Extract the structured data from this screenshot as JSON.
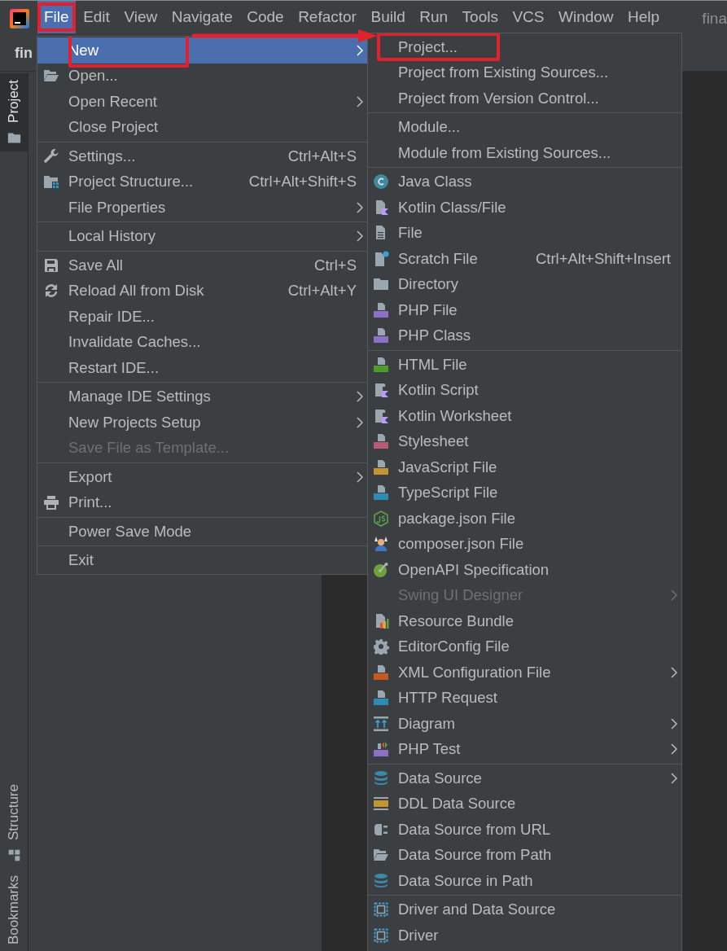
{
  "menu_bar": {
    "items": [
      {
        "label": "File",
        "selected": true,
        "highlighted": true
      },
      {
        "label": "Edit",
        "selected": false,
        "highlighted": false
      },
      {
        "label": "View",
        "selected": false,
        "highlighted": false
      },
      {
        "label": "Navigate",
        "selected": false,
        "highlighted": false
      },
      {
        "label": "Code",
        "selected": false,
        "highlighted": false
      },
      {
        "label": "Refactor",
        "selected": false,
        "highlighted": false
      },
      {
        "label": "Build",
        "selected": false,
        "highlighted": false
      },
      {
        "label": "Run",
        "selected": false,
        "highlighted": false
      },
      {
        "label": "Tools",
        "selected": false,
        "highlighted": false
      },
      {
        "label": "VCS",
        "selected": false,
        "highlighted": false
      },
      {
        "label": "Window",
        "selected": false,
        "highlighted": false
      },
      {
        "label": "Help",
        "selected": false,
        "highlighted": false
      }
    ],
    "title": "fina"
  },
  "navigation_bar": {
    "label": "fin"
  },
  "tool_stripe": [
    {
      "label": "Project",
      "kind": "folder",
      "selected": true
    },
    {
      "label": "Structure",
      "kind": "structure",
      "selected": false
    },
    {
      "label": "Bookmarks",
      "kind": "plain",
      "selected": false
    }
  ],
  "file_menu": {
    "arrow_to_submenu": true,
    "groups": [
      [
        {
          "label": "New",
          "kind": "plain",
          "selected": true,
          "disabled": false,
          "submenu": true,
          "highlighted": true
        },
        {
          "label": "Open...",
          "kind": "folder-open",
          "selected": false,
          "disabled": false,
          "submenu": false,
          "highlighted": false
        },
        {
          "label": "Open Recent",
          "kind": "plain",
          "selected": false,
          "disabled": false,
          "submenu": true,
          "highlighted": false
        },
        {
          "label": "Close Project",
          "kind": "plain",
          "selected": false,
          "disabled": false,
          "submenu": false,
          "highlighted": false
        }
      ],
      [
        {
          "label": "Settings...",
          "kind": "wrench",
          "shortcut": "Ctrl+Alt+S",
          "selected": false,
          "disabled": false,
          "submenu": false,
          "highlighted": false
        },
        {
          "label": "Project Structure...",
          "kind": "project-structure",
          "shortcut": "Ctrl+Alt+Shift+S",
          "selected": false,
          "disabled": false,
          "submenu": false,
          "highlighted": false
        },
        {
          "label": "File Properties",
          "kind": "plain",
          "selected": false,
          "disabled": false,
          "submenu": true,
          "highlighted": false
        }
      ],
      [
        {
          "label": "Local History",
          "kind": "plain",
          "selected": false,
          "disabled": false,
          "submenu": true,
          "highlighted": false
        }
      ],
      [
        {
          "label": "Save All",
          "kind": "floppy",
          "shortcut": "Ctrl+S",
          "selected": false,
          "disabled": false,
          "submenu": false,
          "highlighted": false
        },
        {
          "label": "Reload All from Disk",
          "kind": "reload",
          "shortcut": "Ctrl+Alt+Y",
          "selected": false,
          "disabled": false,
          "submenu": false,
          "highlighted": false
        },
        {
          "label": "Repair IDE...",
          "kind": "plain",
          "selected": false,
          "disabled": false,
          "submenu": false,
          "highlighted": false
        },
        {
          "label": "Invalidate Caches...",
          "kind": "plain",
          "selected": false,
          "disabled": false,
          "submenu": false,
          "highlighted": false
        },
        {
          "label": "Restart IDE...",
          "kind": "plain",
          "selected": false,
          "disabled": false,
          "submenu": false,
          "highlighted": false
        }
      ],
      [
        {
          "label": "Manage IDE Settings",
          "kind": "plain",
          "selected": false,
          "disabled": false,
          "submenu": true,
          "highlighted": false
        },
        {
          "label": "New Projects Setup",
          "kind": "plain",
          "selected": false,
          "disabled": false,
          "submenu": true,
          "highlighted": false
        },
        {
          "label": "Save File as Template...",
          "kind": "plain",
          "selected": false,
          "disabled": true,
          "submenu": false,
          "highlighted": false
        }
      ],
      [
        {
          "label": "Export",
          "kind": "plain",
          "selected": false,
          "disabled": false,
          "submenu": true,
          "highlighted": false
        },
        {
          "label": "Print...",
          "kind": "printer",
          "selected": false,
          "disabled": false,
          "submenu": false,
          "highlighted": false
        }
      ],
      [
        {
          "label": "Power Save Mode",
          "kind": "plain",
          "selected": false,
          "disabled": false,
          "submenu": false,
          "highlighted": false
        }
      ],
      [
        {
          "label": "Exit",
          "kind": "plain",
          "selected": false,
          "disabled": false,
          "submenu": false,
          "highlighted": false
        }
      ]
    ]
  },
  "new_submenu": {
    "groups": [
      [
        {
          "label": "Project...",
          "kind": "plain",
          "selected": false,
          "disabled": false,
          "submenu": false,
          "highlighted": true
        },
        {
          "label": "Project from Existing Sources...",
          "kind": "plain",
          "selected": false,
          "disabled": false,
          "submenu": false,
          "highlighted": false
        },
        {
          "label": "Project from Version Control...",
          "kind": "plain",
          "selected": false,
          "disabled": false,
          "submenu": false,
          "highlighted": false
        }
      ],
      [
        {
          "label": "Module...",
          "kind": "plain",
          "selected": false,
          "disabled": false,
          "submenu": false,
          "highlighted": false
        },
        {
          "label": "Module from Existing Sources...",
          "kind": "plain",
          "selected": false,
          "disabled": false,
          "submenu": false,
          "highlighted": false
        }
      ],
      [
        {
          "label": "Java Class",
          "kind": "java",
          "selected": false,
          "disabled": false,
          "submenu": false,
          "highlighted": false
        },
        {
          "label": "Kotlin Class/File",
          "kind": "kotlin-file",
          "selected": false,
          "disabled": false,
          "submenu": false,
          "highlighted": false
        },
        {
          "label": "File",
          "kind": "file",
          "selected": false,
          "disabled": false,
          "submenu": false,
          "highlighted": false
        },
        {
          "label": "Scratch File",
          "kind": "scratch",
          "shortcut": "Ctrl+Alt+Shift+Insert",
          "selected": false,
          "disabled": false,
          "submenu": false,
          "highlighted": false
        },
        {
          "label": "Directory",
          "kind": "folder",
          "selected": false,
          "disabled": false,
          "submenu": false,
          "highlighted": false
        },
        {
          "label": "PHP File",
          "kind": "php",
          "selected": false,
          "disabled": false,
          "submenu": false,
          "highlighted": false
        },
        {
          "label": "PHP Class",
          "kind": "php",
          "selected": false,
          "disabled": false,
          "submenu": false,
          "highlighted": false
        }
      ],
      [
        {
          "label": "HTML File",
          "kind": "html",
          "selected": false,
          "disabled": false,
          "submenu": false,
          "highlighted": false
        },
        {
          "label": "Kotlin Script",
          "kind": "kotlin-script",
          "selected": false,
          "disabled": false,
          "submenu": false,
          "highlighted": false
        },
        {
          "label": "Kotlin Worksheet",
          "kind": "kotlin-script",
          "selected": false,
          "disabled": false,
          "submenu": false,
          "highlighted": false
        },
        {
          "label": "Stylesheet",
          "kind": "css",
          "selected": false,
          "disabled": false,
          "submenu": false,
          "highlighted": false
        },
        {
          "label": "JavaScript File",
          "kind": "js",
          "selected": false,
          "disabled": false,
          "submenu": false,
          "highlighted": false
        },
        {
          "label": "TypeScript File",
          "kind": "ts",
          "selected": false,
          "disabled": false,
          "submenu": false,
          "highlighted": false
        },
        {
          "label": "package.json File",
          "kind": "nodejs",
          "selected": false,
          "disabled": false,
          "submenu": false,
          "highlighted": false
        },
        {
          "label": "composer.json File",
          "kind": "composer",
          "selected": false,
          "disabled": false,
          "submenu": false,
          "highlighted": false
        },
        {
          "label": "OpenAPI Specification",
          "kind": "openapi",
          "selected": false,
          "disabled": false,
          "submenu": false,
          "highlighted": false
        },
        {
          "label": "Swing UI Designer",
          "kind": "plain",
          "selected": false,
          "disabled": true,
          "submenu": true,
          "highlighted": false
        },
        {
          "label": "Resource Bundle",
          "kind": "bundle",
          "selected": false,
          "disabled": false,
          "submenu": false,
          "highlighted": false
        },
        {
          "label": "EditorConfig File",
          "kind": "gear",
          "selected": false,
          "disabled": false,
          "submenu": false,
          "highlighted": false
        },
        {
          "label": "XML Configuration File",
          "kind": "xml",
          "selected": false,
          "disabled": false,
          "submenu": true,
          "highlighted": false
        },
        {
          "label": "HTTP Request",
          "kind": "api",
          "selected": false,
          "disabled": false,
          "submenu": false,
          "highlighted": false
        },
        {
          "label": "Diagram",
          "kind": "diagram",
          "selected": false,
          "disabled": false,
          "submenu": true,
          "highlighted": false
        },
        {
          "label": "PHP Test",
          "kind": "php-test",
          "selected": false,
          "disabled": false,
          "submenu": true,
          "highlighted": false
        }
      ],
      [
        {
          "label": "Data Source",
          "kind": "database",
          "selected": false,
          "disabled": false,
          "submenu": true,
          "highlighted": false
        },
        {
          "label": "DDL Data Source",
          "kind": "ddl",
          "selected": false,
          "disabled": false,
          "submenu": false,
          "highlighted": false
        },
        {
          "label": "Data Source from URL",
          "kind": "plug",
          "selected": false,
          "disabled": false,
          "submenu": false,
          "highlighted": false
        },
        {
          "label": "Data Source from Path",
          "kind": "folder-open",
          "selected": false,
          "disabled": false,
          "submenu": false,
          "highlighted": false
        },
        {
          "label": "Data Source in Path",
          "kind": "database",
          "selected": false,
          "disabled": false,
          "submenu": false,
          "highlighted": false
        }
      ],
      [
        {
          "label": "Driver and Data Source",
          "kind": "driver",
          "selected": false,
          "disabled": false,
          "submenu": false,
          "highlighted": false
        },
        {
          "label": "Driver",
          "kind": "driver",
          "selected": false,
          "disabled": false,
          "submenu": false,
          "highlighted": false
        }
      ]
    ]
  }
}
